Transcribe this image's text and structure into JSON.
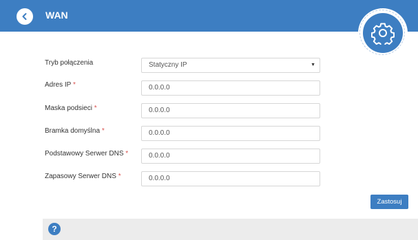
{
  "header": {
    "title": "WAN"
  },
  "icons": {
    "back": "chevron-left-icon",
    "settings": "gear-icon",
    "help": "question-mark-icon"
  },
  "form": {
    "connection_type": {
      "label": "Tryb połączenia",
      "value": "Statyczny IP"
    },
    "ip_address": {
      "label": "Adres IP",
      "required_mark": "*",
      "value": "0.0.0.0"
    },
    "subnet_mask": {
      "label": "Maska podsieci",
      "required_mark": "*",
      "value": "0.0.0.0"
    },
    "gateway": {
      "label": "Bramka domyślna",
      "required_mark": "*",
      "value": "0.0.0.0"
    },
    "primary_dns": {
      "label": "Podstawowy Serwer DNS",
      "required_mark": "*",
      "value": "0.0.0.0"
    },
    "secondary_dns": {
      "label": "Zapasowy Serwer DNS",
      "required_mark": "*",
      "value": "0.0.0.0"
    }
  },
  "actions": {
    "apply_label": "Zastosuj"
  },
  "footer": {
    "help_glyph": "?"
  },
  "colors": {
    "primary": "#3d7ec2",
    "required": "#d9534f",
    "footer_bg": "#ececec"
  }
}
